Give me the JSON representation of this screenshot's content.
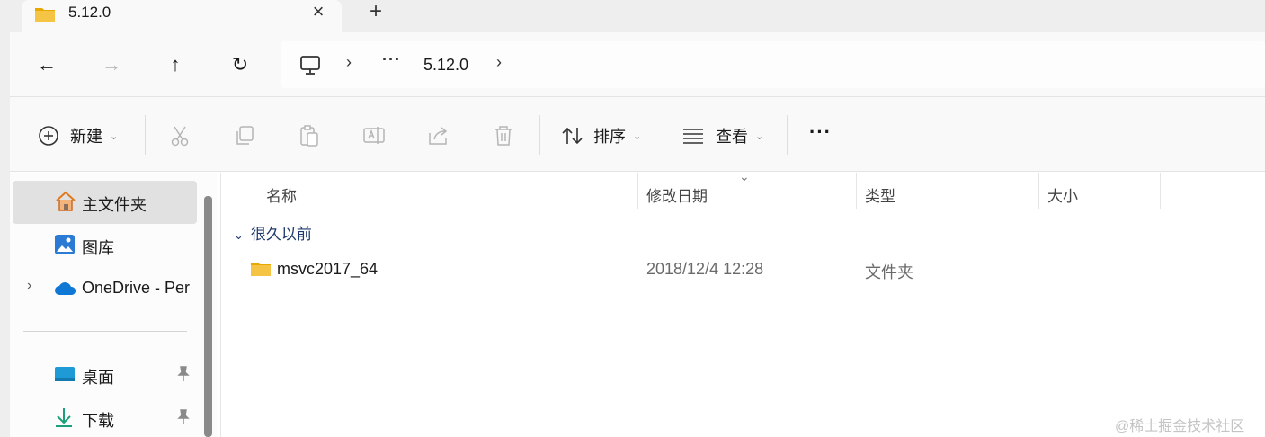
{
  "tab": {
    "title": "5.12.0",
    "close_icon": "×",
    "new_tab_icon": "+"
  },
  "nav": {
    "back": "←",
    "forward": "→",
    "up": "↑",
    "refresh": "↻"
  },
  "address": {
    "separator": "›",
    "overflow": "···",
    "crumbs": [
      "5.12.0"
    ],
    "trailing_separator": "›"
  },
  "commands": {
    "new_label": "新建",
    "sort_label": "排序",
    "view_label": "查看",
    "more": "···",
    "dropdown_chevron": "⌄"
  },
  "sidebar": {
    "items": [
      {
        "label": "主文件夹",
        "icon": "home-icon"
      },
      {
        "label": "图库",
        "icon": "gallery-icon"
      },
      {
        "label": "OneDrive - Per",
        "icon": "cloud-icon",
        "expand": "›"
      },
      {
        "label": "桌面",
        "icon": "desktop-icon"
      },
      {
        "label": "下载",
        "icon": "download-icon"
      }
    ]
  },
  "columns": {
    "name": "名称",
    "date": "修改日期",
    "type": "类型",
    "size": "大小",
    "sort_indicator": "⌄"
  },
  "group": {
    "chevron": "⌄",
    "label": "很久以前"
  },
  "files": [
    {
      "name": "msvc2017_64",
      "modified": "2018/12/4 12:28",
      "type": "文件夹",
      "size": ""
    }
  ],
  "watermark": "@稀土掘金技术社区",
  "colors": {
    "accent": "#1f3a6e",
    "folder": "#f6c445",
    "onedrive": "#0f78d4"
  }
}
